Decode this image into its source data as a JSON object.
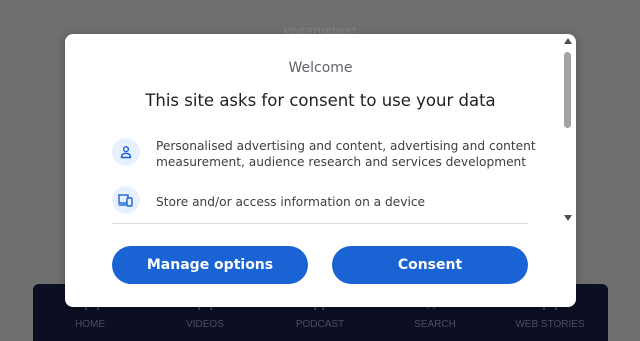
{
  "background": {
    "advertisement_label": "ADVERTISEMENT",
    "nav": [
      "HOME",
      "VIDEOS",
      "PODCAST",
      "SEARCH",
      "WEB STORIES"
    ]
  },
  "consent": {
    "welcome": "Welcome",
    "headline": "This site asks for consent to use your data",
    "purposes": [
      {
        "icon": "person-icon",
        "text": "Personalised advertising and content, advertising and content measurement, audience research and services development"
      },
      {
        "icon": "devices-icon",
        "text": "Store and/or access information on a device"
      }
    ],
    "manage_label": "Manage options",
    "consent_label": "Consent"
  },
  "colors": {
    "button": "#1a63d4",
    "icon_bg": "#e8f0fe",
    "icon_fg": "#1a63d4",
    "overlay": "#6f6f6f",
    "nav_bg": "#0c0f24"
  }
}
